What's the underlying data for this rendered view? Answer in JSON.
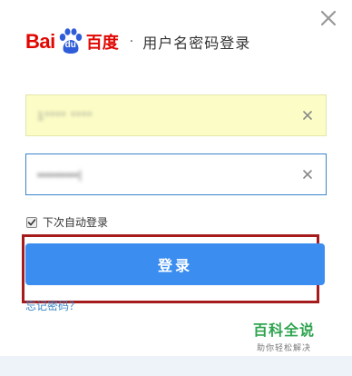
{
  "header": {
    "logo_text_latin": "Bai",
    "logo_text_du": "du",
    "logo_text_cn": "百度",
    "separator": "·",
    "title": "用户名密码登录"
  },
  "form": {
    "username_value": "1**** ****",
    "password_value": "••••••••••|",
    "remember_label": "下次自动登录",
    "remember_checked": true,
    "login_label": "登录",
    "forgot_label": "忘记密码？"
  },
  "watermark": {
    "main": "百科全说",
    "sub": "助你轻松解决"
  },
  "colors": {
    "brand_red": "#e10601",
    "button_blue": "#3b8df0",
    "autofill_yellow": "#fcfdc6",
    "highlight_border": "#a61c1c",
    "watermark_green": "#2ea44f"
  }
}
